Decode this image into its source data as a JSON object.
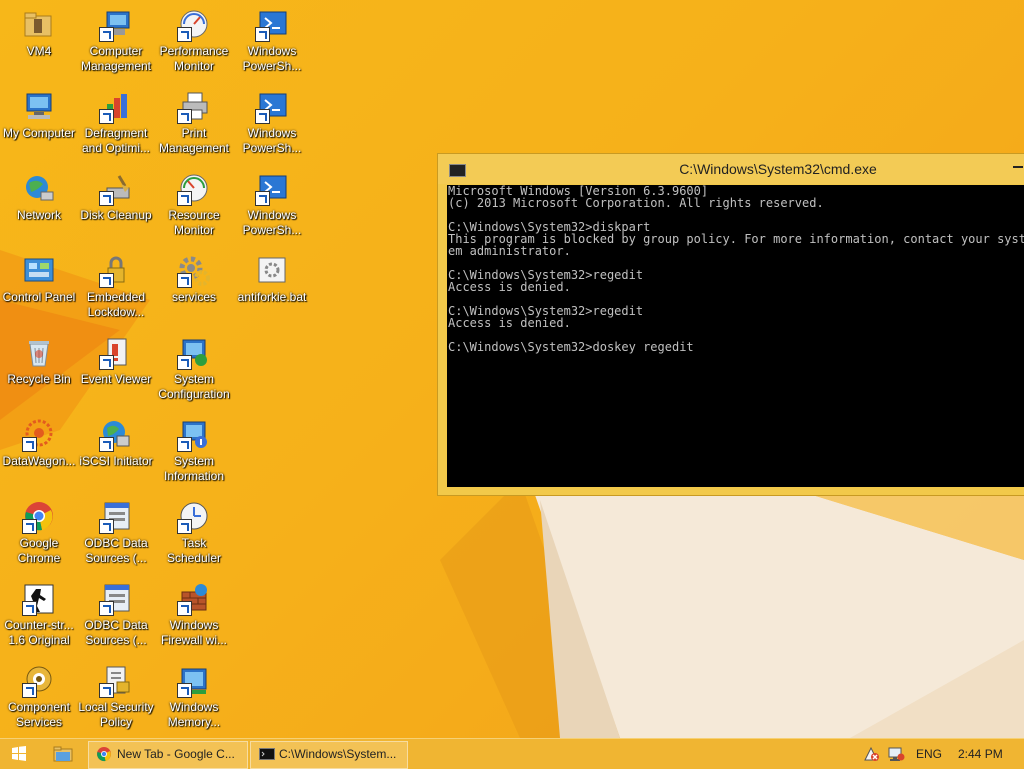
{
  "desktop": {
    "icons": [
      {
        "label": "VM4"
      },
      {
        "label": "My Computer"
      },
      {
        "label": "Network"
      },
      {
        "label": "Control Panel"
      },
      {
        "label": "Recycle Bin"
      },
      {
        "label": "DataWagon..."
      },
      {
        "label": "Google Chrome"
      },
      {
        "label": "Counter-str... 1.6 Original"
      },
      {
        "label": "Component Services"
      },
      {
        "label": "Computer Management"
      },
      {
        "label": "Defragment and Optimi..."
      },
      {
        "label": "Disk Cleanup"
      },
      {
        "label": "Embedded Lockdow..."
      },
      {
        "label": "Event Viewer"
      },
      {
        "label": "iSCSI Initiator"
      },
      {
        "label": "ODBC Data Sources (..."
      },
      {
        "label": "ODBC Data Sources (..."
      },
      {
        "label": "Local Security Policy"
      },
      {
        "label": "Performance Monitor"
      },
      {
        "label": "Print Management"
      },
      {
        "label": "Resource Monitor"
      },
      {
        "label": "services"
      },
      {
        "label": "System Configuration"
      },
      {
        "label": "System Information"
      },
      {
        "label": "Task Scheduler"
      },
      {
        "label": "Windows Firewall wi..."
      },
      {
        "label": "Windows Memory..."
      },
      {
        "label": "Windows PowerSh..."
      },
      {
        "label": "Windows PowerSh..."
      },
      {
        "label": "Windows PowerSh..."
      },
      {
        "label": "antiforkie.bat"
      }
    ]
  },
  "cmd": {
    "title": "C:\\Windows\\System32\\cmd.exe",
    "lines": [
      "Microsoft Windows [Version 6.3.9600]",
      "(c) 2013 Microsoft Corporation. All rights reserved.",
      "",
      "C:\\Windows\\System32>diskpart",
      "This program is blocked by group policy. For more information, contact your syst",
      "em administrator.",
      "",
      "C:\\Windows\\System32>regedit",
      "Access is denied.",
      "",
      "C:\\Windows\\System32>regedit",
      "Access is denied.",
      "",
      "C:\\Windows\\System32>doskey regedit"
    ]
  },
  "taskbar": {
    "tasks": [
      {
        "label": "New Tab - Google C..."
      },
      {
        "label": "C:\\Windows\\System..."
      }
    ],
    "language": "ENG",
    "clock": "2:44 PM"
  },
  "colors": {
    "desktop": "#f6b11a",
    "taskbar": "#f0b532",
    "cmd_frame": "#f2c94a",
    "console_bg": "#000000",
    "console_fg": "#c0c0c0"
  }
}
